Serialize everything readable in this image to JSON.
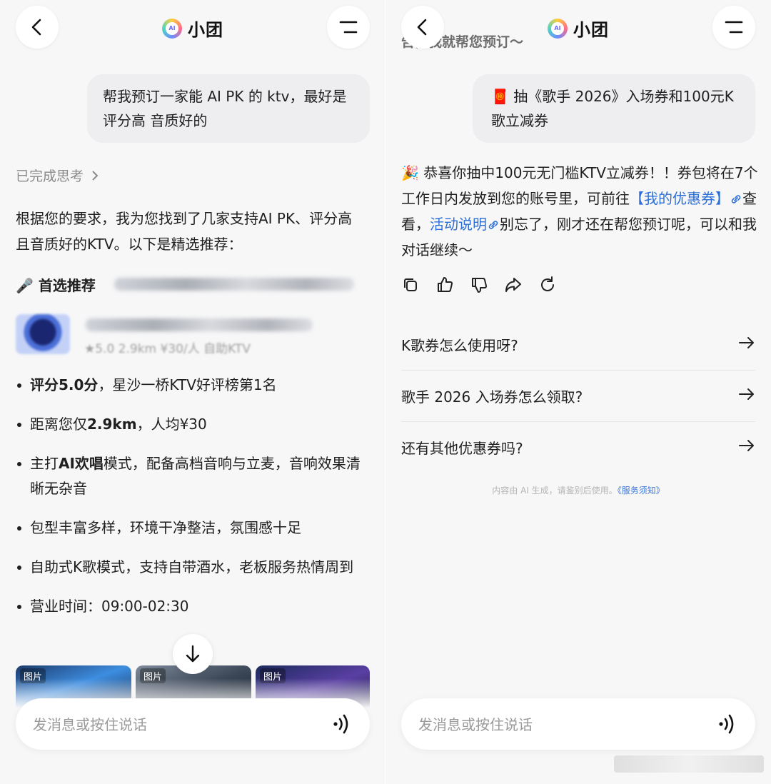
{
  "left": {
    "header": {
      "title": "小团"
    },
    "user_message": "帮我预订一家能 AI PK 的 ktv，最好是评分高 音质好的",
    "thinking_label": "已完成思考",
    "intro": "根据您的要求，我为您找到了几家支持AI PK、评分高且音质好的KTV。以下是精选推荐：",
    "top_pick_label": "🎤 首选推荐",
    "shop_meta": "★5.0   2.9km   ¥30/人   自助KTV",
    "features": [
      {
        "pre": "",
        "bold": "评分5.0分",
        "post": "，星沙一桥KTV好评榜第1名"
      },
      {
        "pre": "距离您仅",
        "bold": "2.9km",
        "post": "，人均¥30"
      },
      {
        "pre": "主打",
        "bold": "AI欢唱",
        "post": "模式，配备高档音响与立麦，音响效果清晰无杂音"
      },
      {
        "pre": "",
        "bold": "",
        "post": "包型丰富多样，环境干净整洁，氛围感十足"
      },
      {
        "pre": "",
        "bold": "",
        "post": "自助式K歌模式，支持自带酒水，老板服务热情周到"
      },
      {
        "pre": "",
        "bold": "",
        "post": "营业时间：09:00-02:30"
      }
    ],
    "image_tags": [
      "图片",
      "图片",
      "图片"
    ],
    "input_placeholder": "发消息或按住说话"
  },
  "right": {
    "header": {
      "title": "小团"
    },
    "top_partial_text": "告，我就帮您预订～",
    "user_message": "🧧 抽《歌手 2026》入场券和100元K歌立减券",
    "reply": {
      "emoji": "🎉",
      "part1": " 恭喜你抽中100元无门槛KTV立减券！！券包将在7个工作日内发放到您的账号里，可前往",
      "link1": "【我的优惠券】",
      "part2": "查看，",
      "link2": "活动说明",
      "part3": "别忘了，刚才还在帮您预订呢，可以和我对话继续～"
    },
    "suggestions": [
      "K歌券怎么使用呀?",
      "歌手 2026 入场券怎么领取?",
      "还有其他优惠券吗?"
    ],
    "disclaimer_text": "内容由 AI 生成，请鉴别后使用。",
    "disclaimer_link": "《服务须知》",
    "input_placeholder": "发消息或按住说话"
  },
  "colors": {
    "accent_link": "#2d6fd6",
    "background": "#f7f7f8",
    "bubble": "#eeeef1"
  },
  "icons": [
    "back-icon",
    "menu-icon",
    "app-logo-icon",
    "chevron-right-icon",
    "microphone-icon",
    "scroll-down-icon",
    "voice-icon",
    "copy-icon",
    "thumbs-up-icon",
    "thumbs-down-icon",
    "share-icon",
    "refresh-icon",
    "arrow-right-icon",
    "red-envelope-icon",
    "party-popper-icon",
    "link-icon"
  ]
}
